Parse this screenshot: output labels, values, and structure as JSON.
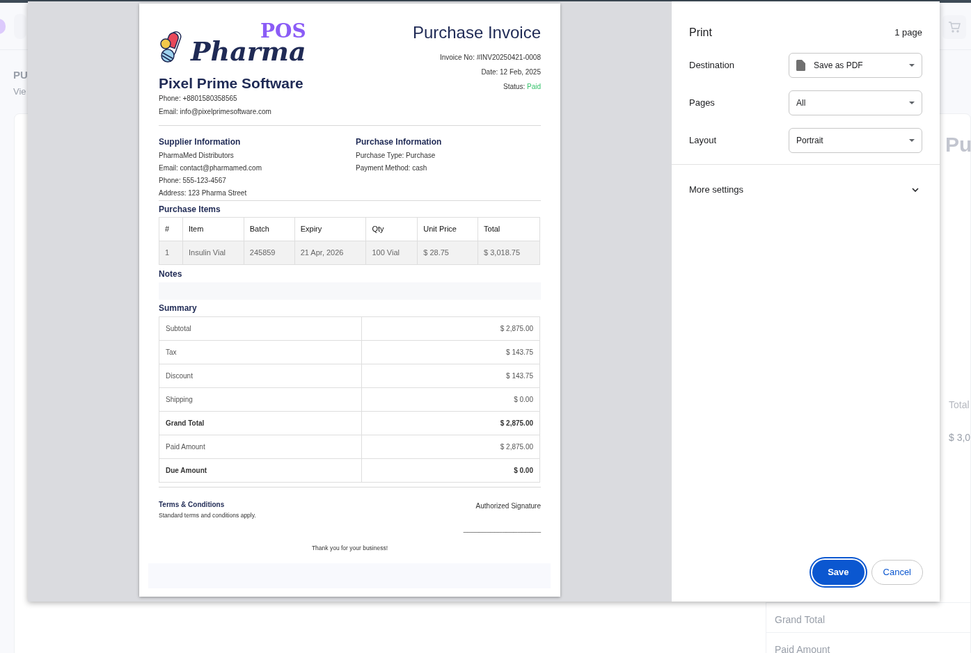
{
  "background_page": {
    "title": "PU",
    "subtitle": "Vie",
    "panel_title": "Pu",
    "column_header": "Total",
    "cell": "$ 3,0",
    "summary_labels": [
      "Grand Total",
      "Paid Amount"
    ]
  },
  "print_dialog": {
    "title": "Print",
    "page_count": "1 page",
    "settings": [
      {
        "label": "Destination",
        "value": "Save as PDF",
        "kind": "destination"
      },
      {
        "label": "Pages",
        "value": "All",
        "kind": "select"
      },
      {
        "label": "Layout",
        "value": "Portrait",
        "kind": "select"
      }
    ],
    "more_settings": {
      "label": "More settings",
      "expanded": false
    },
    "buttons": [
      {
        "label": "Save",
        "kind": "primary"
      },
      {
        "label": "Cancel",
        "kind": "secondary"
      }
    ]
  },
  "invoice": {
    "logo": {
      "top": "POS",
      "bottom": "Pharma"
    },
    "company": "Pixel Prime Software",
    "phone": "Phone: +8801580358565",
    "email": "Email: info@pixelprimesoftware.com",
    "title": "Purchase Invoice",
    "invoice_no": "Invoice No: #INV20250421-0008",
    "date": "Date: 12 Feb, 2025",
    "status_label": "Status:",
    "status": "Paid",
    "supplier": {
      "heading": "Supplier Information",
      "lines": [
        "PharmaMed Distributors",
        "Email: contact@pharmamed.com",
        "Phone: 555-123-4567",
        "Address: 123 Pharma Street"
      ]
    },
    "purchase": {
      "heading": "Purchase Information",
      "lines": [
        "Purchase Type: Purchase",
        "Payment Method: cash"
      ]
    },
    "items": {
      "heading": "Purchase Items",
      "columns": [
        "#",
        "Item",
        "Batch",
        "Expiry",
        "Qty",
        "Unit Price",
        "Total"
      ],
      "rows": [
        [
          "1",
          "Insulin Vial",
          "245859",
          "21 Apr, 2026",
          "100 Vial",
          "$ 28.75",
          "$ 3,018.75"
        ]
      ]
    },
    "notes_heading": "Notes",
    "summary": {
      "heading": "Summary",
      "rows": [
        {
          "label": "Subtotal",
          "value": "$ 2,875.00",
          "emphasis": false
        },
        {
          "label": "Tax",
          "value": "$ 143.75",
          "emphasis": false
        },
        {
          "label": "Discount",
          "value": "$ 143.75",
          "emphasis": false
        },
        {
          "label": "Shipping",
          "value": "$ 0.00",
          "emphasis": false
        },
        {
          "label": "Grand Total",
          "value": "$ 2,875.00",
          "emphasis": true
        },
        {
          "label": "Paid Amount",
          "value": "$ 2,875.00",
          "emphasis": false
        },
        {
          "label": "Due Amount",
          "value": "$ 0.00",
          "emphasis": true
        }
      ]
    },
    "terms_heading": "Terms & Conditions",
    "terms_text": "Standard terms and conditions apply.",
    "signature_label": "Authorized Signature",
    "signature_line": "____________________",
    "thanks": "Thank you for your business!"
  }
}
